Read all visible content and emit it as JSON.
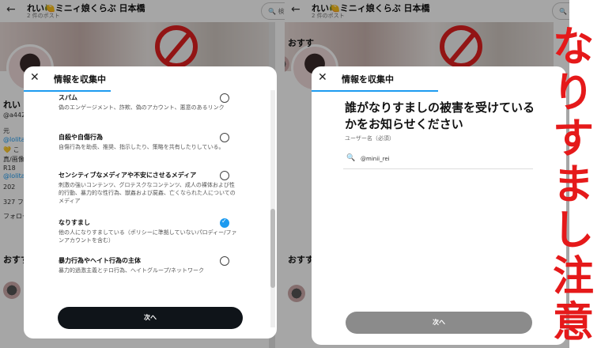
{
  "profile": {
    "title": "れい🍋ミニィ娘くらぶ 日本橋",
    "posts": "2 件のポスト",
    "name_short": "れい",
    "handle_partial": "@a442",
    "bio_fragments": [
      "元",
      "@lolita",
      "💛 こ",
      "真/画像",
      "R18",
      "@lolita"
    ],
    "date_fragment": "202",
    "follow_fragment": "327 フ",
    "follow_label": "フォロー",
    "recommend": "おすす",
    "search_placeholder": "検索"
  },
  "modal1": {
    "title": "情報を収集中",
    "options": [
      {
        "title": "スパム",
        "desc": "偽のエンゲージメント、詐欺、偽のアカウント、悪意のあるリンク",
        "checked": false
      },
      {
        "title": "自殺や自傷行為",
        "desc": "自傷行為を助長、推奨、指示したり、策略を共有したりしている。",
        "checked": false
      },
      {
        "title": "センシティブなメディアや不安にさせるメディア",
        "desc": "刺激の強いコンテンツ、グロテスクなコンテンツ、成人の裸体および性的行動、暴力的な性行為、獣姦および屍姦、亡くなられた人についてのメディア",
        "checked": false
      },
      {
        "title": "なりすまし",
        "desc": "他の人になりすましている（ポリシーに準拠していないパロディー/ファンアカウントを含む）",
        "checked": true
      },
      {
        "title": "暴力行為やヘイト行為の主体",
        "desc": "暴力的過激主義とテロ行為、ヘイトグループ/ネットワーク",
        "checked": false
      }
    ],
    "next_label": "次へ"
  },
  "modal2": {
    "title": "情報を収集中",
    "question": "誰がなりすましの被害を受けているかをお知らせください",
    "field_label": "ユーザー名（必須）",
    "field_value": "@minii_rei",
    "next_label": "次へ"
  },
  "warning": {
    "chars": [
      "な",
      "り",
      "す",
      "ま",
      "し",
      "注",
      "意"
    ],
    "color": "#e5191a"
  },
  "colors": {
    "accent": "#1d9bf0",
    "dark_button": "#0f1419",
    "disabled_button": "#8b8b8b"
  }
}
